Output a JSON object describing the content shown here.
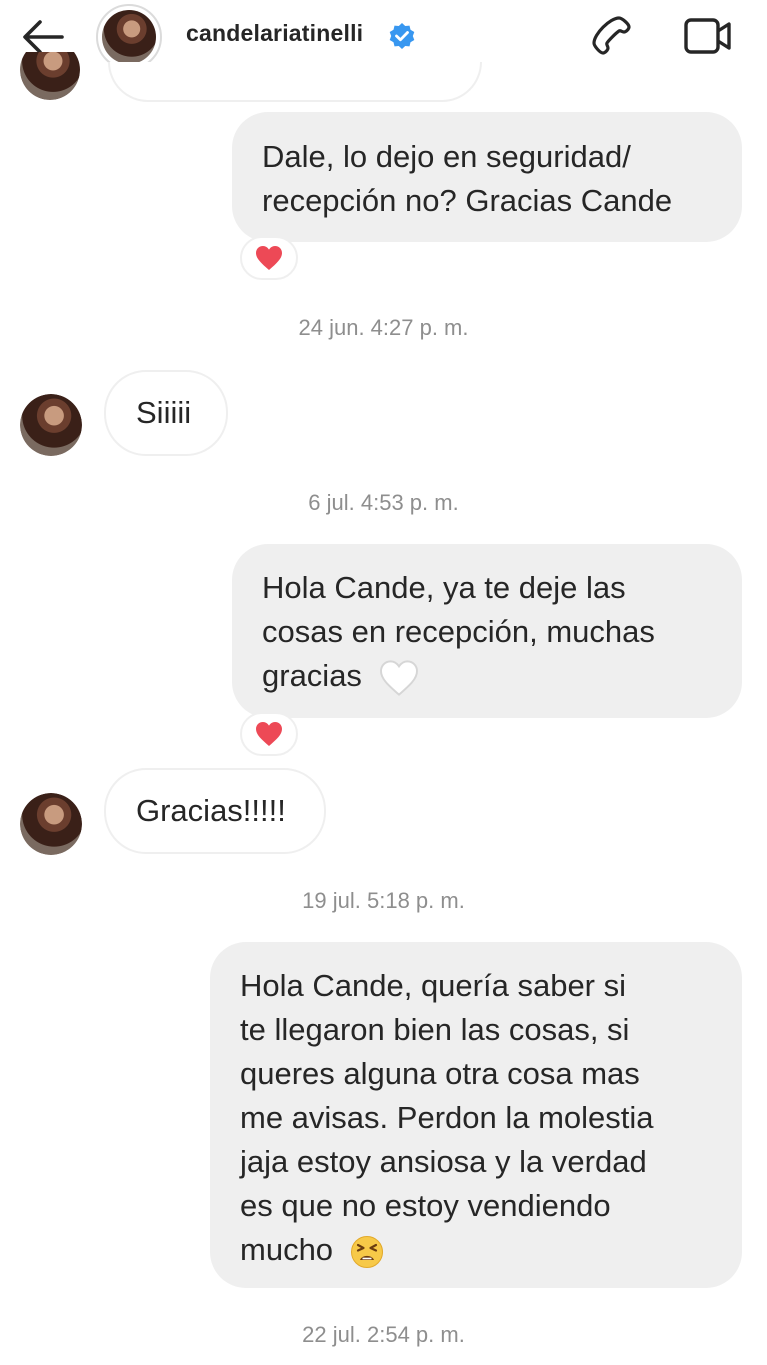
{
  "header": {
    "back_icon": "arrow-left-icon",
    "username": "candelariatinelli",
    "verified_icon": "verified-badge-icon",
    "call_icon": "phone-icon",
    "video_icon": "video-camera-icon"
  },
  "messages": [
    {
      "from": "me",
      "lines": [
        "Dale, lo dejo en seguridad/",
        "recepción no? Gracias Cande"
      ],
      "reaction": "red-heart-icon"
    },
    {
      "timestamp": "24 jun. 4:27 p. m."
    },
    {
      "from": "them",
      "lines": [
        "Siiiii"
      ]
    },
    {
      "timestamp": "6 jul. 4:53 p. m."
    },
    {
      "from": "me",
      "lines": [
        "Hola Cande, ya te deje las",
        "cosas en recepción, muchas",
        "gracias"
      ],
      "inline_emoji": "white-heart-icon",
      "reaction": "red-heart-icon"
    },
    {
      "from": "them",
      "lines": [
        "Gracias!!!!!"
      ]
    },
    {
      "timestamp": "19 jul. 5:18 p. m."
    },
    {
      "from": "me",
      "lines": [
        "Hola Cande, quería saber si",
        "te llegaron bien las cosas, si",
        "queres alguna otra cosa mas",
        "me avisas. Perdon la molestia",
        "jaja estoy ansiosa y la verdad",
        "es que no estoy vendiendo",
        "mucho"
      ],
      "inline_emoji": "tired-face-emoji-icon"
    },
    {
      "timestamp": "22 jul. 2:54 p. m."
    }
  ],
  "colors": {
    "sent_bubble": "#efefef",
    "text": "#262626",
    "timestamp": "#8e8e8e",
    "verified": "#3897f0",
    "heart": "#ed4956"
  }
}
